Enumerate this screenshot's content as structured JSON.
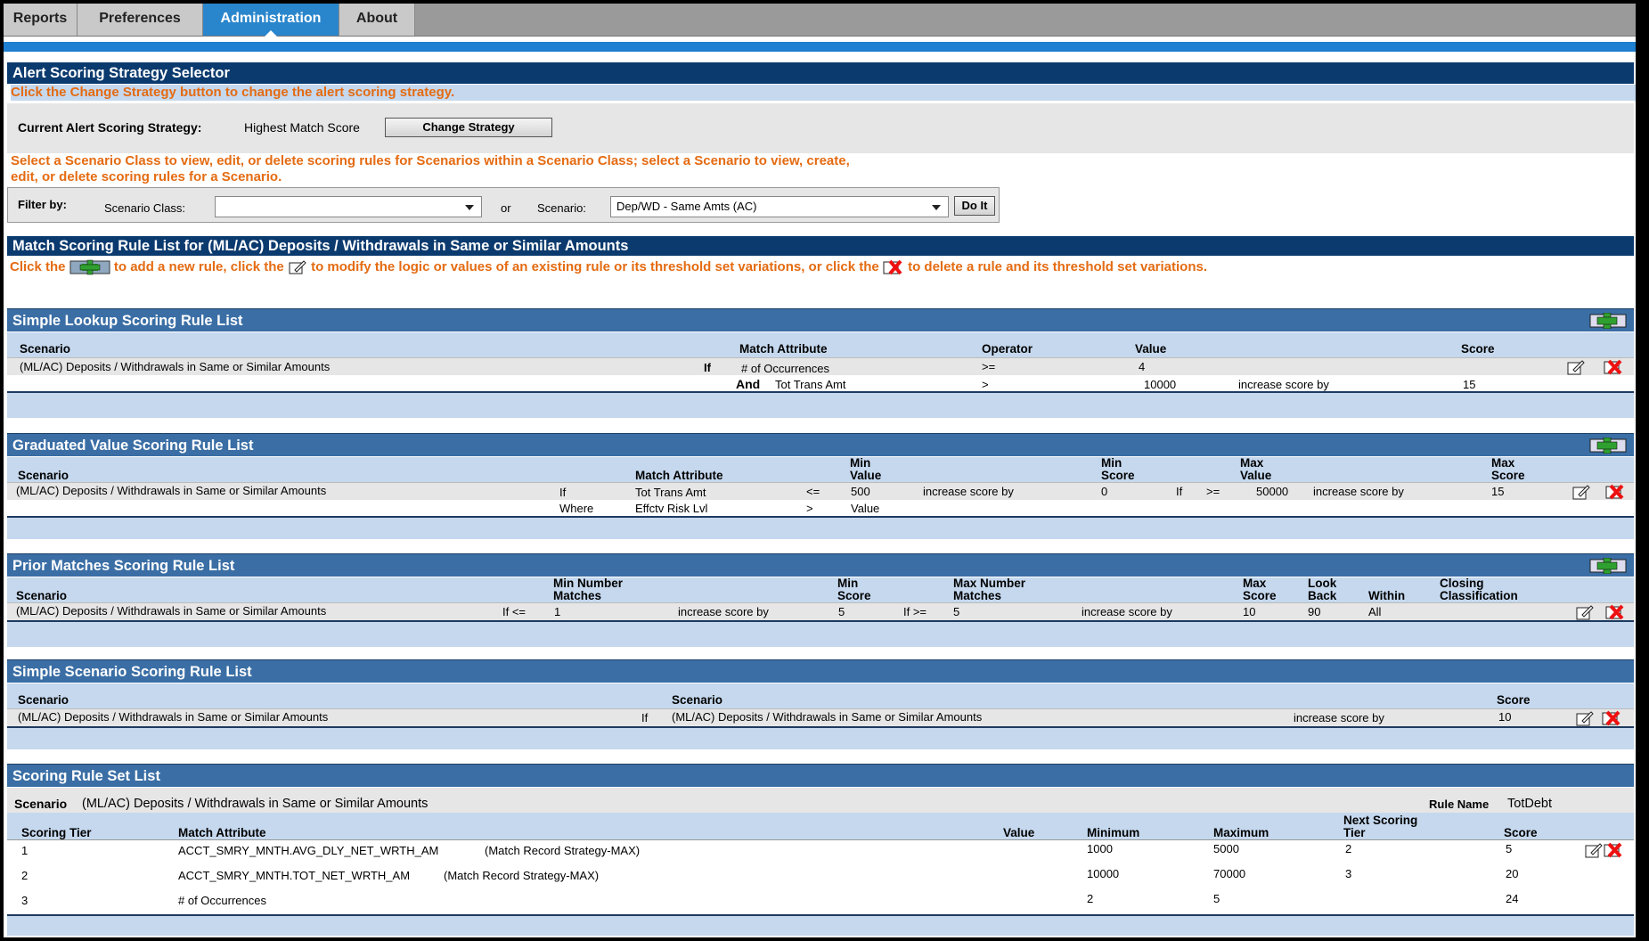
{
  "tabs": [
    {
      "label": "Reports"
    },
    {
      "label": "Preferences"
    },
    {
      "label": "Administration",
      "active": true
    },
    {
      "label": "About"
    }
  ],
  "selector": {
    "title": "Alert Scoring Strategy Selector",
    "instruction": "Click the Change Strategy button to change the alert scoring strategy.",
    "current_label": "Current Alert Scoring Strategy:",
    "current_value": "Highest Match Score",
    "change_button": "Change Strategy"
  },
  "filter": {
    "instruction_line1": "Select a Scenario Class to view, edit, or delete scoring rules for Scenarios within a Scenario Class; select a Scenario to view, create,",
    "instruction_line2": "edit, or delete scoring rules for a Scenario.",
    "filter_by": "Filter by:",
    "scenario_class_label": "Scenario Class:",
    "scenario_class_value": "",
    "or": "or",
    "scenario_label": "Scenario:",
    "scenario_value": "Dep/WD - Same Amts (AC)",
    "do_it": "Do It"
  },
  "rule_list": {
    "title": "Match Scoring Rule List for (ML/AC) Deposits / Withdrawals in Same or Similar Amounts",
    "hint_part1": "Click the",
    "hint_part2": "to add a new rule, click the",
    "hint_part3": "to modify the logic or values of an existing rule or its threshold set variations, or click the",
    "hint_part4": "to delete a rule and its threshold set variations."
  },
  "simple_lookup": {
    "title": "Simple Lookup Scoring Rule List",
    "headers": {
      "scenario": "Scenario",
      "match_attribute": "Match Attribute",
      "operator": "Operator",
      "value": "Value",
      "score": "Score"
    },
    "row1": {
      "scenario": "(ML/AC) Deposits / Withdrawals in Same or Similar Amounts",
      "if": "If",
      "attribute": "# of Occurrences",
      "operator": ">=",
      "value": "4"
    },
    "row2": {
      "and": "And",
      "attribute": "Tot Trans Amt",
      "operator": ">",
      "value": "10000",
      "increase": "increase score by",
      "score": "15"
    }
  },
  "graduated": {
    "title": "Graduated Value Scoring Rule List",
    "headers": {
      "scenario": "Scenario",
      "match_attribute": "Match Attribute",
      "min_value_1": "Min",
      "min_value_2": "Value",
      "min_score_1": "Min",
      "min_score_2": "Score",
      "max_value_1": "Max",
      "max_value_2": "Value",
      "max_score_1": "Max",
      "max_score_2": "Score"
    },
    "row1": {
      "scenario": "(ML/AC) Deposits / Withdrawals in Same or Similar Amounts",
      "if": "If",
      "attribute": "Tot Trans Amt",
      "op1": "<=",
      "min_value": "500",
      "increase1": "increase score by",
      "min_score": "0",
      "if2": "If",
      "op2": ">=",
      "max_value": "50000",
      "increase2": "increase score by",
      "max_score": "15"
    },
    "row2": {
      "where": "Where",
      "attribute": "Effctv Risk Lvl",
      "op": ">",
      "value": "Value"
    }
  },
  "prior": {
    "title": "Prior Matches Scoring Rule List",
    "headers": {
      "scenario": "Scenario",
      "min_num_1": "Min Number",
      "min_num_2": "Matches",
      "min_score_1": "Min",
      "min_score_2": "Score",
      "max_num_1": "Max Number",
      "max_num_2": "Matches",
      "max_score_1": "Max",
      "max_score_2": "Score",
      "look_1": "Look",
      "look_2": "Back",
      "within": "Within",
      "closing_1": "Closing",
      "closing_2": "Classification"
    },
    "row1": {
      "scenario": "(ML/AC) Deposits / Withdrawals in Same or Similar Amounts",
      "if_le": "If <=",
      "min_num": "1",
      "increase1": "increase score by",
      "min_score": "5",
      "if_ge": "If >=",
      "max_num": "5",
      "increase2": "increase score by",
      "max_score": "10",
      "look_back": "90",
      "within": "All"
    }
  },
  "simple_scenario": {
    "title": "Simple Scenario Scoring Rule List",
    "headers": {
      "scenario": "Scenario",
      "scenario2": "Scenario",
      "score": "Score"
    },
    "row1": {
      "scenario": "(ML/AC) Deposits / Withdrawals in Same or Similar Amounts",
      "if": "If",
      "scenario2": "(ML/AC) Deposits / Withdrawals in Same or Similar Amounts",
      "increase": "increase score by",
      "score": "10"
    }
  },
  "rule_set": {
    "title": "Scoring Rule Set List",
    "scenario_label": "Scenario",
    "scenario_value": "(ML/AC) Deposits / Withdrawals in Same or Similar Amounts",
    "rule_name_label": "Rule Name",
    "rule_name_value": "TotDebt",
    "headers": {
      "tier": "Scoring Tier",
      "match_attribute": "Match Attribute",
      "value": "Value",
      "minimum": "Minimum",
      "maximum": "Maximum",
      "next_1": "Next Scoring",
      "next_2": "Tier",
      "score": "Score"
    },
    "rows": [
      {
        "tier": "1",
        "attribute": "ACCT_SMRY_MNTH.AVG_DLY_NET_WRTH_AM",
        "strategy": "(Match Record Strategy-MAX)",
        "minimum": "1000",
        "maximum": "5000",
        "next": "2",
        "score": "5"
      },
      {
        "tier": "2",
        "attribute": "ACCT_SMRY_MNTH.TOT_NET_WRTH_AM",
        "strategy": "(Match Record Strategy-MAX)",
        "minimum": "10000",
        "maximum": "70000",
        "next": "3",
        "score": "20"
      },
      {
        "tier": "3",
        "attribute": "# of Occurrences",
        "strategy": "",
        "minimum": "2",
        "maximum": "5",
        "next": "",
        "score": "24"
      }
    ]
  }
}
